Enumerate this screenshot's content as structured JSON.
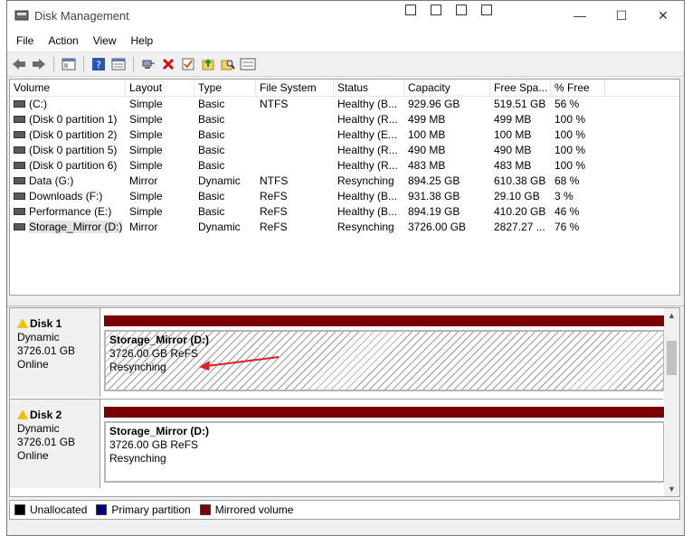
{
  "window": {
    "title": "Disk Management",
    "min": "—",
    "max": "☐",
    "close": "✕"
  },
  "menu": [
    "File",
    "Action",
    "View",
    "Help"
  ],
  "columns": [
    "Volume",
    "Layout",
    "Type",
    "File System",
    "Status",
    "Capacity",
    "Free Spa...",
    "% Free"
  ],
  "volumes": [
    [
      "(C:)",
      "Simple",
      "Basic",
      "NTFS",
      "Healthy (B...",
      "929.96 GB",
      "519.51 GB",
      "56 %"
    ],
    [
      "(Disk 0 partition 1)",
      "Simple",
      "Basic",
      "",
      "Healthy (R...",
      "499 MB",
      "499 MB",
      "100 %"
    ],
    [
      "(Disk 0 partition 2)",
      "Simple",
      "Basic",
      "",
      "Healthy (E...",
      "100 MB",
      "100 MB",
      "100 %"
    ],
    [
      "(Disk 0 partition 5)",
      "Simple",
      "Basic",
      "",
      "Healthy (R...",
      "490 MB",
      "490 MB",
      "100 %"
    ],
    [
      "(Disk 0 partition 6)",
      "Simple",
      "Basic",
      "",
      "Healthy (R...",
      "483 MB",
      "483 MB",
      "100 %"
    ],
    [
      "Data (G:)",
      "Mirror",
      "Dynamic",
      "NTFS",
      "Resynching",
      "894.25 GB",
      "610.38 GB",
      "68 %"
    ],
    [
      "Downloads (F:)",
      "Simple",
      "Basic",
      "ReFS",
      "Healthy (B...",
      "931.38 GB",
      "29.10 GB",
      "3 %"
    ],
    [
      "Performance (E:)",
      "Simple",
      "Basic",
      "ReFS",
      "Healthy (B...",
      "894.19 GB",
      "410.20 GB",
      "46 %"
    ],
    [
      "Storage_Mirror (D:)",
      "Mirror",
      "Dynamic",
      "ReFS",
      "Resynching",
      "3726.00 GB",
      "2827.27 ...",
      "76 %"
    ]
  ],
  "disks": [
    {
      "name": "Disk 1",
      "type": "Dynamic",
      "size": "3726.01 GB",
      "state": "Online",
      "vol_name": "Storage_Mirror  (D:)",
      "vol_size": "3726.00 GB ReFS",
      "vol_status": "Resynching"
    },
    {
      "name": "Disk 2",
      "type": "Dynamic",
      "size": "3726.01 GB",
      "state": "Online",
      "vol_name": "Storage_Mirror  (D:)",
      "vol_size": "3726.00 GB ReFS",
      "vol_status": "Resynching"
    }
  ],
  "legend": [
    {
      "label": "Unallocated",
      "color": "#000000"
    },
    {
      "label": "Primary partition",
      "color": "#000080"
    },
    {
      "label": "Mirrored volume",
      "color": "#7b0000"
    }
  ],
  "annotation_color": "#e02020"
}
